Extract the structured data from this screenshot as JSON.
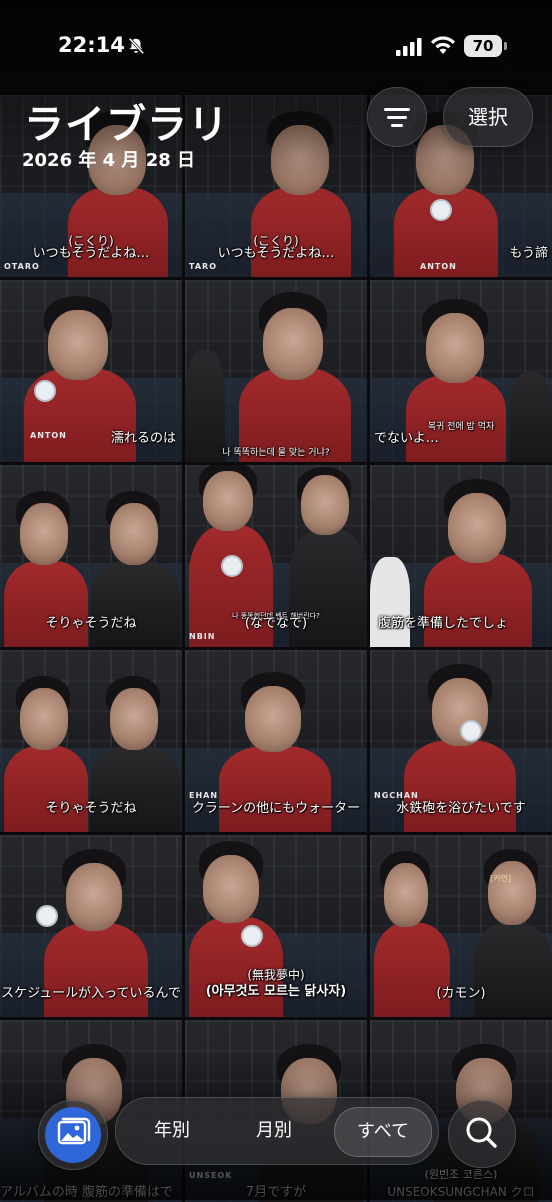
{
  "status_bar": {
    "time": "22:14",
    "battery": "70",
    "icons": [
      "bell-slash-icon",
      "cellular-signal-icon",
      "wifi-icon",
      "battery-icon"
    ]
  },
  "header": {
    "title": "ライブラリ",
    "date": "2026 年 4 月 28 日",
    "sort_icon": "sort-lines-icon",
    "select_label": "選択"
  },
  "grid": {
    "captions": [
      {
        "top": "(こくり)",
        "bottom": "いつもそうだよね…",
        "tag": "OTARO"
      },
      {
        "top": "(こくり)",
        "bottom": "いつもそうだよね…",
        "tag": "TARO"
      },
      {
        "top": "",
        "bottom": "もう諦",
        "tag": "ANTON"
      },
      {
        "top": "",
        "bottom": "濡れるのは",
        "tag": "ANTON"
      },
      {
        "top": "나 똑똑하는데 물 맞는 거냐?",
        "bottom": "",
        "tag": ""
      },
      {
        "top": "복귀 전에 밥 먹자",
        "bottom": "でないよ…",
        "tag": ""
      },
      {
        "top": "",
        "bottom": "そりゃそうだね",
        "tag": ""
      },
      {
        "top": "나 똥똥했던데 벤트 해버린다?",
        "bottom": "(なでなで)",
        "tag": "NBIN"
      },
      {
        "top": "",
        "bottom": "腹筋を準備したでしょ",
        "tag": ""
      },
      {
        "top": "",
        "bottom": "そりゃそうだね",
        "tag": ""
      },
      {
        "top": "",
        "bottom": "クラーンの他にもウォーター",
        "tag": "EHAN"
      },
      {
        "top": "",
        "bottom": "水鉄砲を浴びたいです",
        "tag": "NGCHAN"
      },
      {
        "top": "",
        "bottom": "スケジュールが入っているんで",
        "tag": ""
      },
      {
        "top": "(無我夢中)",
        "bottom": "(아무것도 모르는 닭사자)",
        "tag": ""
      },
      {
        "top": "[커먼]",
        "bottom": "(カモン)",
        "tag": ""
      },
      {
        "top": "",
        "bottom": "アルバムの時 腹筋の準備はで",
        "tag": ""
      },
      {
        "top": "",
        "bottom": "7月ですが",
        "tag": "UNSEOK"
      },
      {
        "top": "(원빈조 코른스)",
        "bottom": "UNSEOKSUNGCHAN クロ",
        "tag": ""
      }
    ]
  },
  "bottom_bar": {
    "library_icon": "photo-library-icon",
    "tabs": [
      "年別",
      "月別",
      "すべて"
    ],
    "active_tab": "すべて",
    "search_icon": "search-icon"
  },
  "colors": {
    "accent": "#2f67d8",
    "shirt_red": "#9a2628",
    "background": "#0b0b0d"
  }
}
